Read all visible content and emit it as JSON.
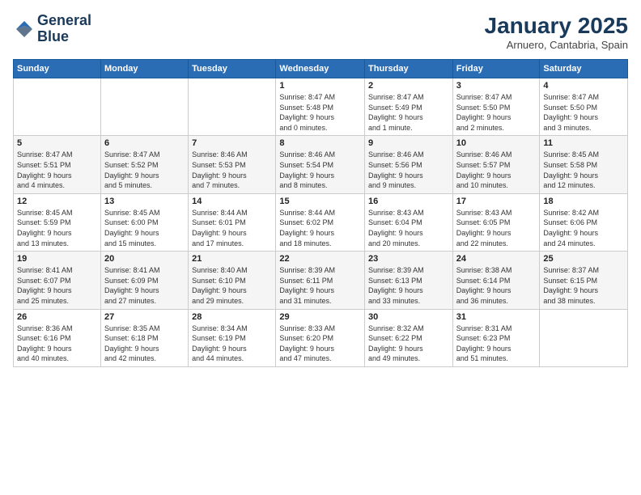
{
  "logo": {
    "line1": "General",
    "line2": "Blue"
  },
  "title": "January 2025",
  "subtitle": "Arnuero, Cantabria, Spain",
  "weekdays": [
    "Sunday",
    "Monday",
    "Tuesday",
    "Wednesday",
    "Thursday",
    "Friday",
    "Saturday"
  ],
  "weeks": [
    [
      {
        "day": "",
        "info": ""
      },
      {
        "day": "",
        "info": ""
      },
      {
        "day": "",
        "info": ""
      },
      {
        "day": "1",
        "info": "Sunrise: 8:47 AM\nSunset: 5:48 PM\nDaylight: 9 hours\nand 0 minutes."
      },
      {
        "day": "2",
        "info": "Sunrise: 8:47 AM\nSunset: 5:49 PM\nDaylight: 9 hours\nand 1 minute."
      },
      {
        "day": "3",
        "info": "Sunrise: 8:47 AM\nSunset: 5:50 PM\nDaylight: 9 hours\nand 2 minutes."
      },
      {
        "day": "4",
        "info": "Sunrise: 8:47 AM\nSunset: 5:50 PM\nDaylight: 9 hours\nand 3 minutes."
      }
    ],
    [
      {
        "day": "5",
        "info": "Sunrise: 8:47 AM\nSunset: 5:51 PM\nDaylight: 9 hours\nand 4 minutes."
      },
      {
        "day": "6",
        "info": "Sunrise: 8:47 AM\nSunset: 5:52 PM\nDaylight: 9 hours\nand 5 minutes."
      },
      {
        "day": "7",
        "info": "Sunrise: 8:46 AM\nSunset: 5:53 PM\nDaylight: 9 hours\nand 7 minutes."
      },
      {
        "day": "8",
        "info": "Sunrise: 8:46 AM\nSunset: 5:54 PM\nDaylight: 9 hours\nand 8 minutes."
      },
      {
        "day": "9",
        "info": "Sunrise: 8:46 AM\nSunset: 5:56 PM\nDaylight: 9 hours\nand 9 minutes."
      },
      {
        "day": "10",
        "info": "Sunrise: 8:46 AM\nSunset: 5:57 PM\nDaylight: 9 hours\nand 10 minutes."
      },
      {
        "day": "11",
        "info": "Sunrise: 8:45 AM\nSunset: 5:58 PM\nDaylight: 9 hours\nand 12 minutes."
      }
    ],
    [
      {
        "day": "12",
        "info": "Sunrise: 8:45 AM\nSunset: 5:59 PM\nDaylight: 9 hours\nand 13 minutes."
      },
      {
        "day": "13",
        "info": "Sunrise: 8:45 AM\nSunset: 6:00 PM\nDaylight: 9 hours\nand 15 minutes."
      },
      {
        "day": "14",
        "info": "Sunrise: 8:44 AM\nSunset: 6:01 PM\nDaylight: 9 hours\nand 17 minutes."
      },
      {
        "day": "15",
        "info": "Sunrise: 8:44 AM\nSunset: 6:02 PM\nDaylight: 9 hours\nand 18 minutes."
      },
      {
        "day": "16",
        "info": "Sunrise: 8:43 AM\nSunset: 6:04 PM\nDaylight: 9 hours\nand 20 minutes."
      },
      {
        "day": "17",
        "info": "Sunrise: 8:43 AM\nSunset: 6:05 PM\nDaylight: 9 hours\nand 22 minutes."
      },
      {
        "day": "18",
        "info": "Sunrise: 8:42 AM\nSunset: 6:06 PM\nDaylight: 9 hours\nand 24 minutes."
      }
    ],
    [
      {
        "day": "19",
        "info": "Sunrise: 8:41 AM\nSunset: 6:07 PM\nDaylight: 9 hours\nand 25 minutes."
      },
      {
        "day": "20",
        "info": "Sunrise: 8:41 AM\nSunset: 6:09 PM\nDaylight: 9 hours\nand 27 minutes."
      },
      {
        "day": "21",
        "info": "Sunrise: 8:40 AM\nSunset: 6:10 PM\nDaylight: 9 hours\nand 29 minutes."
      },
      {
        "day": "22",
        "info": "Sunrise: 8:39 AM\nSunset: 6:11 PM\nDaylight: 9 hours\nand 31 minutes."
      },
      {
        "day": "23",
        "info": "Sunrise: 8:39 AM\nSunset: 6:13 PM\nDaylight: 9 hours\nand 33 minutes."
      },
      {
        "day": "24",
        "info": "Sunrise: 8:38 AM\nSunset: 6:14 PM\nDaylight: 9 hours\nand 36 minutes."
      },
      {
        "day": "25",
        "info": "Sunrise: 8:37 AM\nSunset: 6:15 PM\nDaylight: 9 hours\nand 38 minutes."
      }
    ],
    [
      {
        "day": "26",
        "info": "Sunrise: 8:36 AM\nSunset: 6:16 PM\nDaylight: 9 hours\nand 40 minutes."
      },
      {
        "day": "27",
        "info": "Sunrise: 8:35 AM\nSunset: 6:18 PM\nDaylight: 9 hours\nand 42 minutes."
      },
      {
        "day": "28",
        "info": "Sunrise: 8:34 AM\nSunset: 6:19 PM\nDaylight: 9 hours\nand 44 minutes."
      },
      {
        "day": "29",
        "info": "Sunrise: 8:33 AM\nSunset: 6:20 PM\nDaylight: 9 hours\nand 47 minutes."
      },
      {
        "day": "30",
        "info": "Sunrise: 8:32 AM\nSunset: 6:22 PM\nDaylight: 9 hours\nand 49 minutes."
      },
      {
        "day": "31",
        "info": "Sunrise: 8:31 AM\nSunset: 6:23 PM\nDaylight: 9 hours\nand 51 minutes."
      },
      {
        "day": "",
        "info": ""
      }
    ]
  ]
}
